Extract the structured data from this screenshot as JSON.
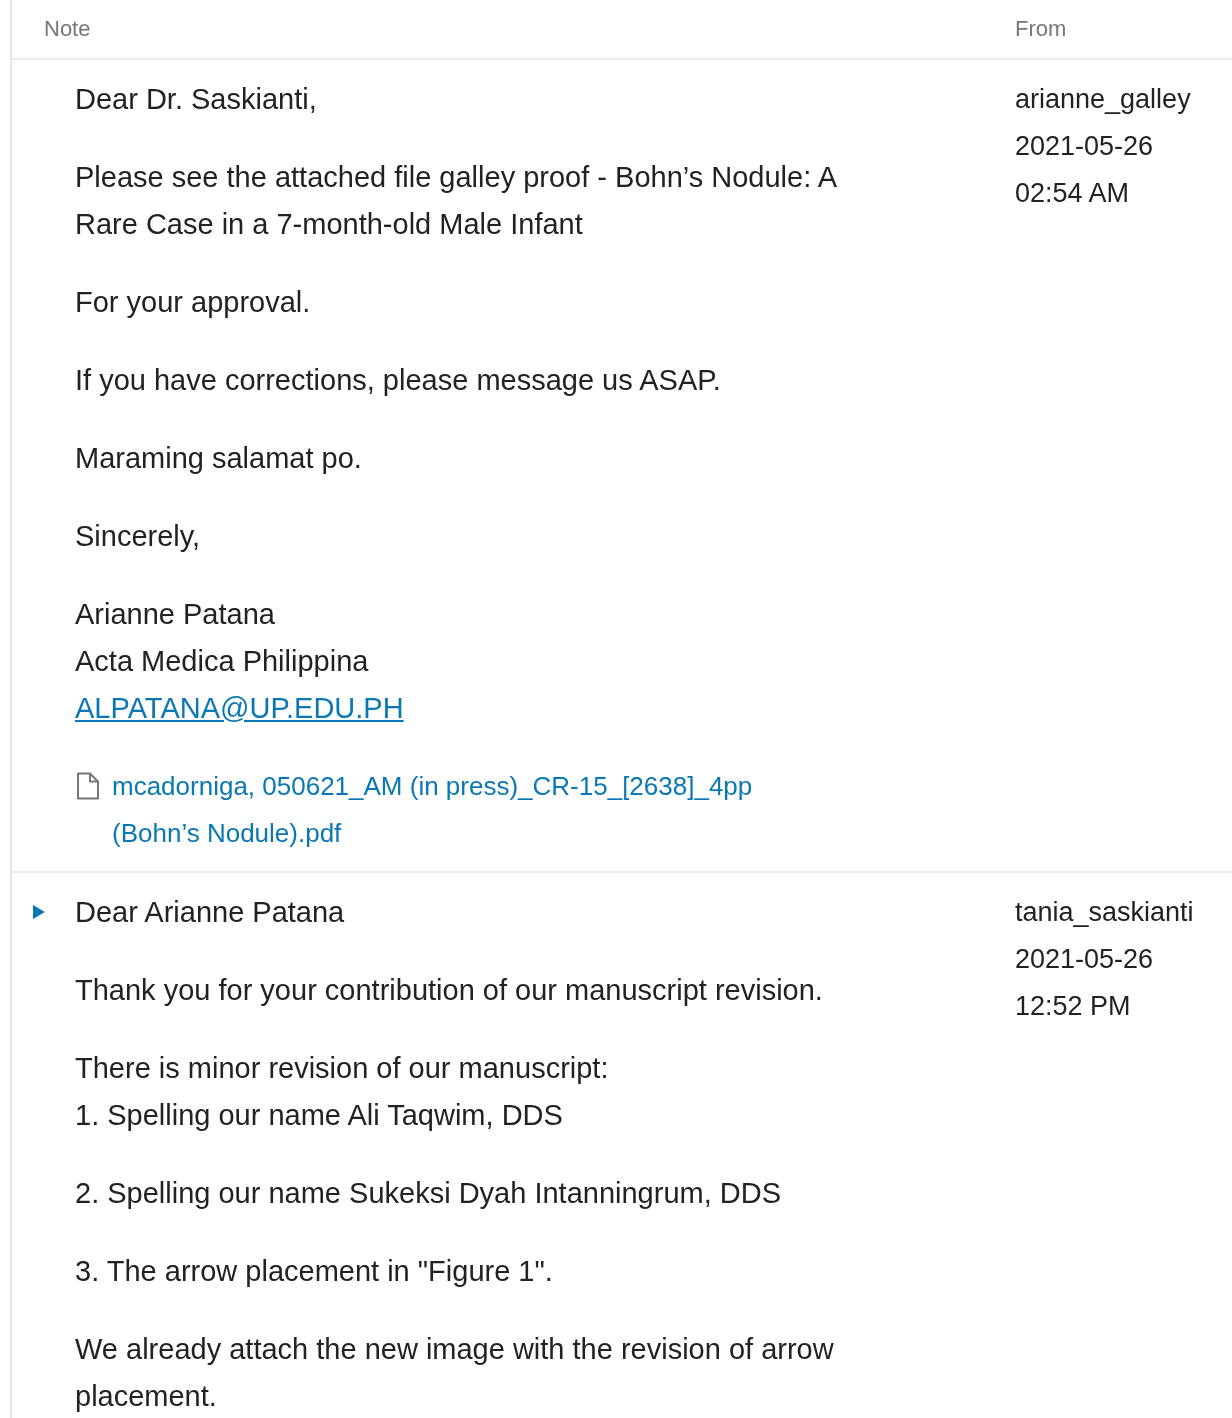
{
  "header": {
    "note": "Note",
    "from": "From"
  },
  "notes": [
    {
      "expandable": false,
      "from": "arianne_galley",
      "date": "2021-05-26",
      "time": "02:54 AM",
      "paragraphs": [
        {
          "lines": [
            "Dear Dr. Saskianti,"
          ]
        },
        {
          "lines": [
            "Please see the attached file galley proof - Bohn’s Nodule: A",
            "Rare Case in a 7-month-old Male Infant"
          ]
        },
        {
          "lines": [
            "For your approval."
          ]
        },
        {
          "lines": [
            "If you have corrections, please message us ASAP."
          ]
        },
        {
          "lines": [
            "Maraming salamat po."
          ]
        },
        {
          "lines": [
            "Sincerely,"
          ]
        },
        {
          "lines": [
            "Arianne Patana",
            "Acta Medica Philippina"
          ],
          "email": "ALPATANA@UP.EDU.PH"
        }
      ],
      "attachment": [
        "mcadorniga, 050621_AM (in press)_CR-15_[2638]_4pp",
        "(Bohn’s Nodule).pdf"
      ]
    },
    {
      "expandable": true,
      "from": "tania_saskianti",
      "date": "2021-05-26",
      "time": "12:52 PM",
      "paragraphs": [
        {
          "lines": [
            "Dear Arianne Patana"
          ]
        },
        {
          "lines": [
            "Thank you for your contribution of our manuscript revision."
          ]
        },
        {
          "lines": [
            "There is minor revision of our manuscript:",
            "1. Spelling our name Ali Taqwim, DDS"
          ]
        },
        {
          "lines": [
            "2. Spelling our name Sukeksi Dyah Intanningrum, DDS"
          ]
        },
        {
          "lines": [
            "3. The arrow placement in \"Figure 1\"."
          ]
        },
        {
          "lines": [
            "We already attach the new image with the revision of arrow",
            "placement."
          ]
        }
      ]
    }
  ]
}
